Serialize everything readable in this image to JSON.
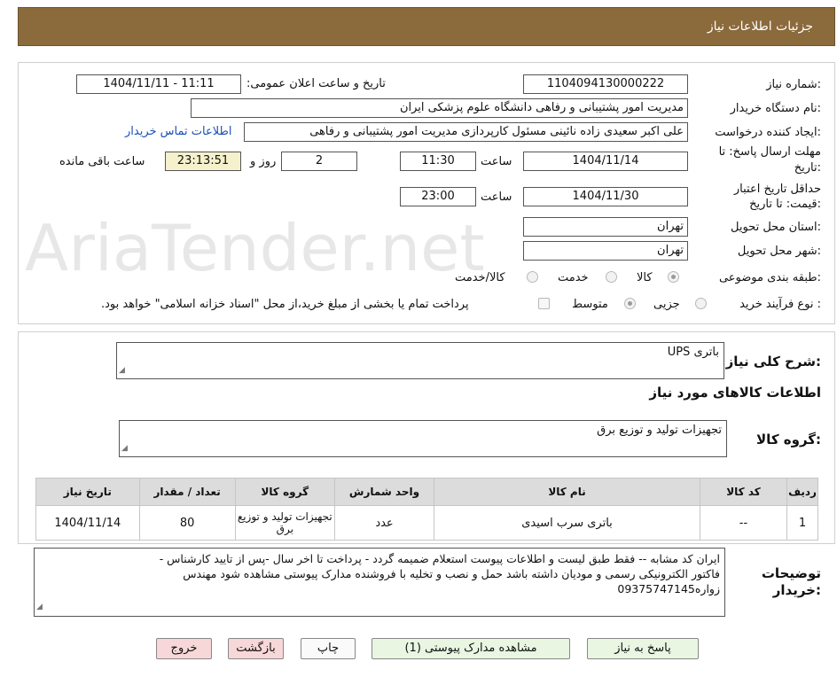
{
  "header": {
    "title": "جزئیات اطلاعات نیاز"
  },
  "fields": {
    "need_number_label": "شماره نیاز:",
    "need_number": "1104094130000222",
    "announce_label": "تاریخ و ساعت اعلان عمومی:",
    "announce_value": "1404/11/11 - 11:11",
    "buyer_org_label": "نام دستگاه خریدار:",
    "buyer_org": "مدیریت امور پشتیبانی و رفاهی دانشگاه علوم پزشکی ایران",
    "requester_label": "ایجاد کننده درخواست:",
    "requester": "علی اکبر سعیدی زاده نائینی مسئول کارپردازی مدیریت امور پشتیبانی و رفاهی",
    "contact_link": "اطلاعات تماس خریدار",
    "deadline_label_1": "مهلت ارسال پاسخ: تا",
    "deadline_label_2": "تاریخ:",
    "deadline_date": "1404/11/14",
    "time_label": "ساعت",
    "deadline_time": "11:30",
    "days_value": "2",
    "days_label": "روز و",
    "remaining_time": "23:13:51",
    "remaining_label": "ساعت باقی مانده",
    "validity_label_1": "حداقل تاریخ اعتبار",
    "validity_label_2": "قیمت: تا تاریخ:",
    "validity_date": "1404/11/30",
    "validity_time": "23:00",
    "province_label": "استان محل تحویل:",
    "province": "تهران",
    "city_label": "شهر محل تحویل:",
    "city": "تهران",
    "category_label": "طبقه بندی موضوعی:",
    "category_options": [
      "کالا",
      "خدمت",
      "کالا/خدمت"
    ],
    "process_label": "نوع فرآیند خرید :",
    "process_options": [
      "جزیی",
      "متوسط"
    ],
    "payment_note": "پرداخت تمام یا بخشی از مبلغ خرید،از محل \"اسناد خزانه اسلامی\" خواهد بود."
  },
  "general": {
    "summary_label": "شرح کلی نیاز:",
    "summary": "باتری UPS",
    "goods_info_title": "اطلاعات کالاهای مورد نیاز",
    "goods_group_label": "گروه کالا:",
    "goods_group": "تجهیزات تولید و توزیع برق"
  },
  "table": {
    "headers": [
      "ردیف",
      "کد کالا",
      "نام کالا",
      "واحد شمارش",
      "گروه کالا",
      "تعداد / مقدار",
      "تاریخ نیاز"
    ],
    "rows": [
      [
        "1",
        "--",
        "باتری سرب اسیدی",
        "عدد",
        "تجهیزات تولید و توزیع برق",
        "80",
        "1404/11/14"
      ]
    ]
  },
  "notes": {
    "label_1": "توضیحات",
    "label_2": "خریدار:",
    "line_1": "ایران کد مشابه -- فقط طبق لیست و اطلاعات پیوست استعلام ضمیمه گردد - پرداخت تا اخر سال -پس از تایید کارشناس -",
    "line_2": "فاکتور الکترونیکی رسمی و مودیان داشته باشد  حمل و نصب و تخلیه با فروشنده مدارک پیوستی مشاهده شود مهندس",
    "line_3": "زواره09375747145"
  },
  "buttons": {
    "reply": "پاسخ به نیاز",
    "attachments": "مشاهده مدارک پیوستی (1)",
    "print": "چاپ",
    "back": "بازگشت",
    "exit": "خروج"
  },
  "watermark": "AriaTender.net"
}
